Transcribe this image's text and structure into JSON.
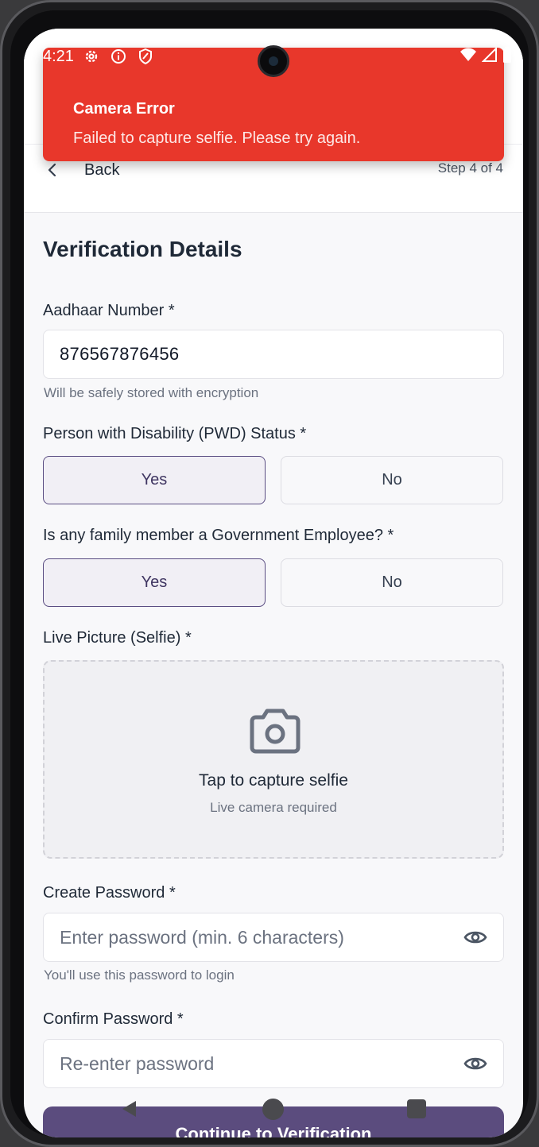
{
  "status_bar": {
    "time": "4:21",
    "left_icons": [
      "gear-icon",
      "info-icon",
      "shield-icon"
    ],
    "right_icons": [
      "wifi-icon",
      "signal-icon",
      "battery-icon"
    ]
  },
  "toast": {
    "title": "Camera Error",
    "message": "Failed to capture selfie. Please try again.",
    "color": "#e8372b"
  },
  "header": {
    "back_label": "Back",
    "step_text": "Step 4 of 4"
  },
  "page_title": "Verification Details",
  "aadhaar": {
    "label": "Aadhaar Number *",
    "value": "876567876456",
    "helper": "Will be safely stored with encryption"
  },
  "pwd_status": {
    "label": "Person with Disability (PWD) Status *",
    "options": [
      "Yes",
      "No"
    ],
    "selected": "Yes"
  },
  "gov_employee": {
    "label": "Is any family member a Government Employee? *",
    "options": [
      "Yes",
      "No"
    ],
    "selected": "Yes"
  },
  "selfie": {
    "label": "Live Picture (Selfie) *",
    "title": "Tap to capture selfie",
    "subtitle": "Live camera required"
  },
  "password": {
    "label": "Create Password *",
    "placeholder": "Enter password (min. 6 characters)",
    "helper": "You'll use this password to login"
  },
  "confirm_password": {
    "label": "Confirm Password *",
    "placeholder": "Re-enter password"
  },
  "continue_label": "Continue to Verification",
  "colors": {
    "accent": "#5b4c7e",
    "selected_bg": "#f1eff5",
    "error": "#e8372b"
  }
}
